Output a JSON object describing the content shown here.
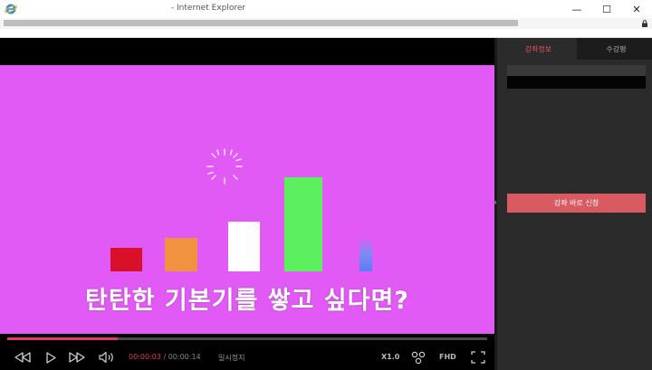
{
  "window": {
    "title": "- Internet Explorer",
    "minimize_glyph": "—",
    "maximize_glyph": "☐",
    "close_glyph": "✕"
  },
  "video": {
    "caption": "탄탄한 기본기를 쌓고 싶다면?",
    "current_time": "00:00:03",
    "separator": " / ",
    "total_time": "00:00:14",
    "status_label": "일시정지",
    "speed_label": "X1.0",
    "quality_label": "FHD",
    "progress_fraction": 0.23,
    "colors": {
      "stage": "#e15af5",
      "progress": "#e8386a"
    },
    "icons": [
      "rewind-icon",
      "play-icon",
      "fast-forward-icon",
      "volume-icon",
      "share-icon",
      "fullscreen-icon",
      "firework-icon"
    ]
  },
  "sidebar": {
    "tabs": [
      {
        "label": "강좌정보",
        "active": true
      },
      {
        "label": "수강평",
        "active": false
      }
    ],
    "enroll_button": "강좌 바로 신청",
    "accent_color": "#d95a60"
  }
}
